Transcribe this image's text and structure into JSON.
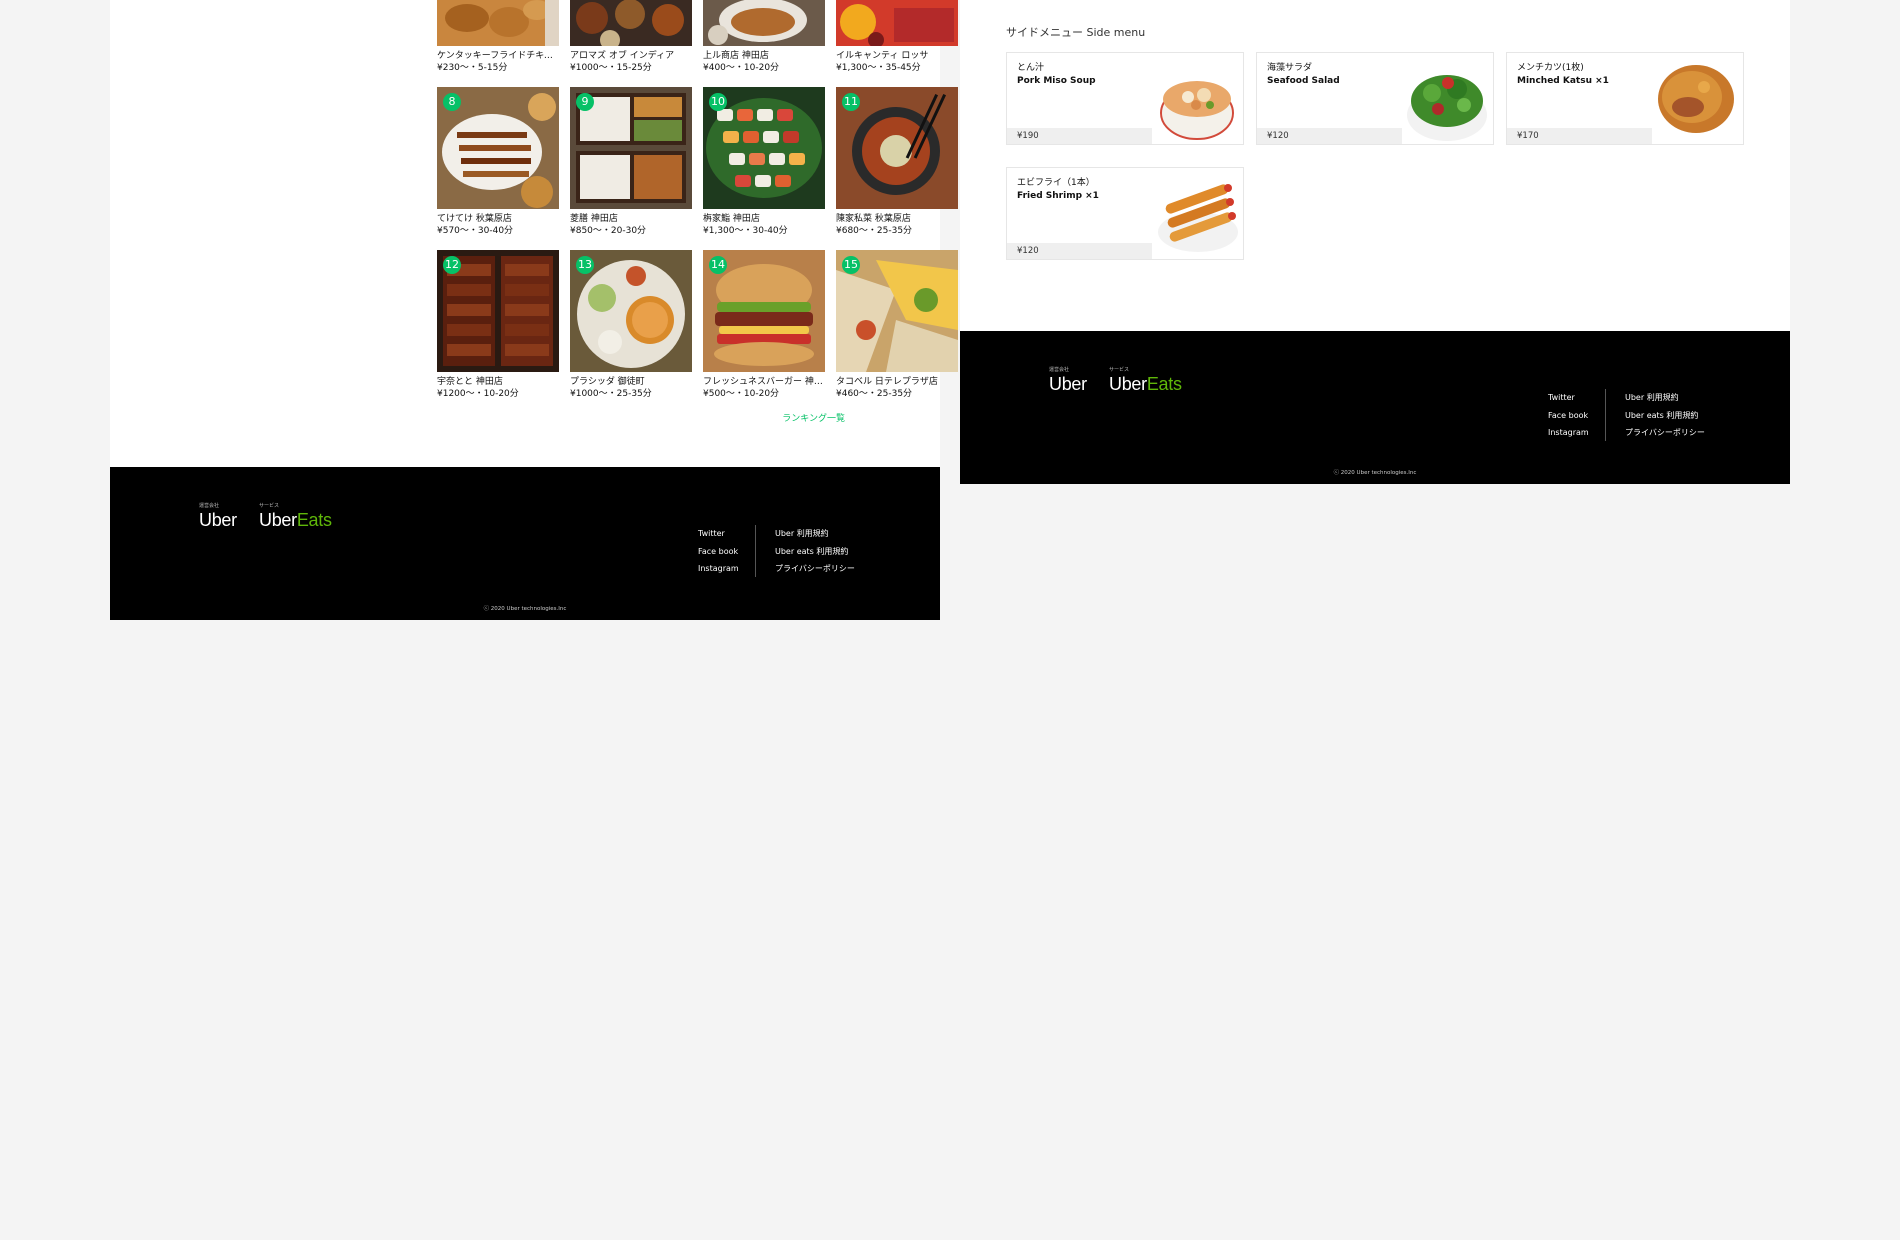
{
  "ranking": {
    "link_label": "ランキング一覧",
    "items": [
      {
        "rank": "",
        "name": "ケンタッキーフライドチキン ...",
        "meta": "¥230〜・5-15分"
      },
      {
        "rank": "",
        "name": "アロマズ オブ インディア",
        "meta": "¥1000〜・15-25分"
      },
      {
        "rank": "",
        "name": "上ル商店 神田店",
        "meta": "¥400〜・10-20分"
      },
      {
        "rank": "",
        "name": "イルキャンティ ロッサ",
        "meta": "¥1,300〜・35-45分"
      },
      {
        "rank": "8",
        "name": "てけてけ 秋葉原店",
        "meta": "¥570〜・30-40分"
      },
      {
        "rank": "9",
        "name": "菱膳 神田店",
        "meta": "¥850〜・20-30分"
      },
      {
        "rank": "10",
        "name": "栴家鮨 神田店",
        "meta": "¥1,300〜・30-40分"
      },
      {
        "rank": "11",
        "name": "陳家私菜 秋葉原店",
        "meta": "¥680〜・25-35分"
      },
      {
        "rank": "12",
        "name": "宇奈とと 神田店",
        "meta": "¥1200〜・10-20分"
      },
      {
        "rank": "13",
        "name": "プラシッダ 御徒町",
        "meta": "¥1000〜・25-35分"
      },
      {
        "rank": "14",
        "name": "フレッシュネスバーガー 神 ...",
        "meta": "¥500〜・10-20分"
      },
      {
        "rank": "15",
        "name": "タコベル 日テレプラザ店",
        "meta": "¥460〜・25-35分"
      }
    ]
  },
  "side_menu": {
    "title": "サイドメニュー Side menu",
    "items": [
      {
        "jp": "とん汁",
        "en": "Pork Miso Soup",
        "price": "¥190"
      },
      {
        "jp": "海藻サラダ",
        "en": "Seafood Salad",
        "price": "¥120"
      },
      {
        "jp": "メンチカツ(1枚)",
        "en": "Minched Katsu ×1",
        "price": "¥170"
      },
      {
        "jp": "エビフライ（1本）",
        "en": "Fried Shrimp ×1",
        "price": "¥120"
      }
    ]
  },
  "footer": {
    "uber_small": "運営会社",
    "uber_word": "Uber",
    "service_small": "サービス",
    "ubereats_word_uber": "Uber",
    "ubereats_word_eats": "Eats",
    "social_links": [
      "Twitter",
      "Face book",
      "Instagram"
    ],
    "policy_links": [
      "Uber 利用規約",
      "Uber  eats 利用規約",
      "プライバシーポリシー"
    ],
    "copyright": "ⓒ 2020 Uber technologies.Inc"
  },
  "colors": {
    "accent_green": "#06c167",
    "eats_green": "#5fb709",
    "footer_bg": "#000000",
    "page_bg": "#f4f4f4"
  }
}
